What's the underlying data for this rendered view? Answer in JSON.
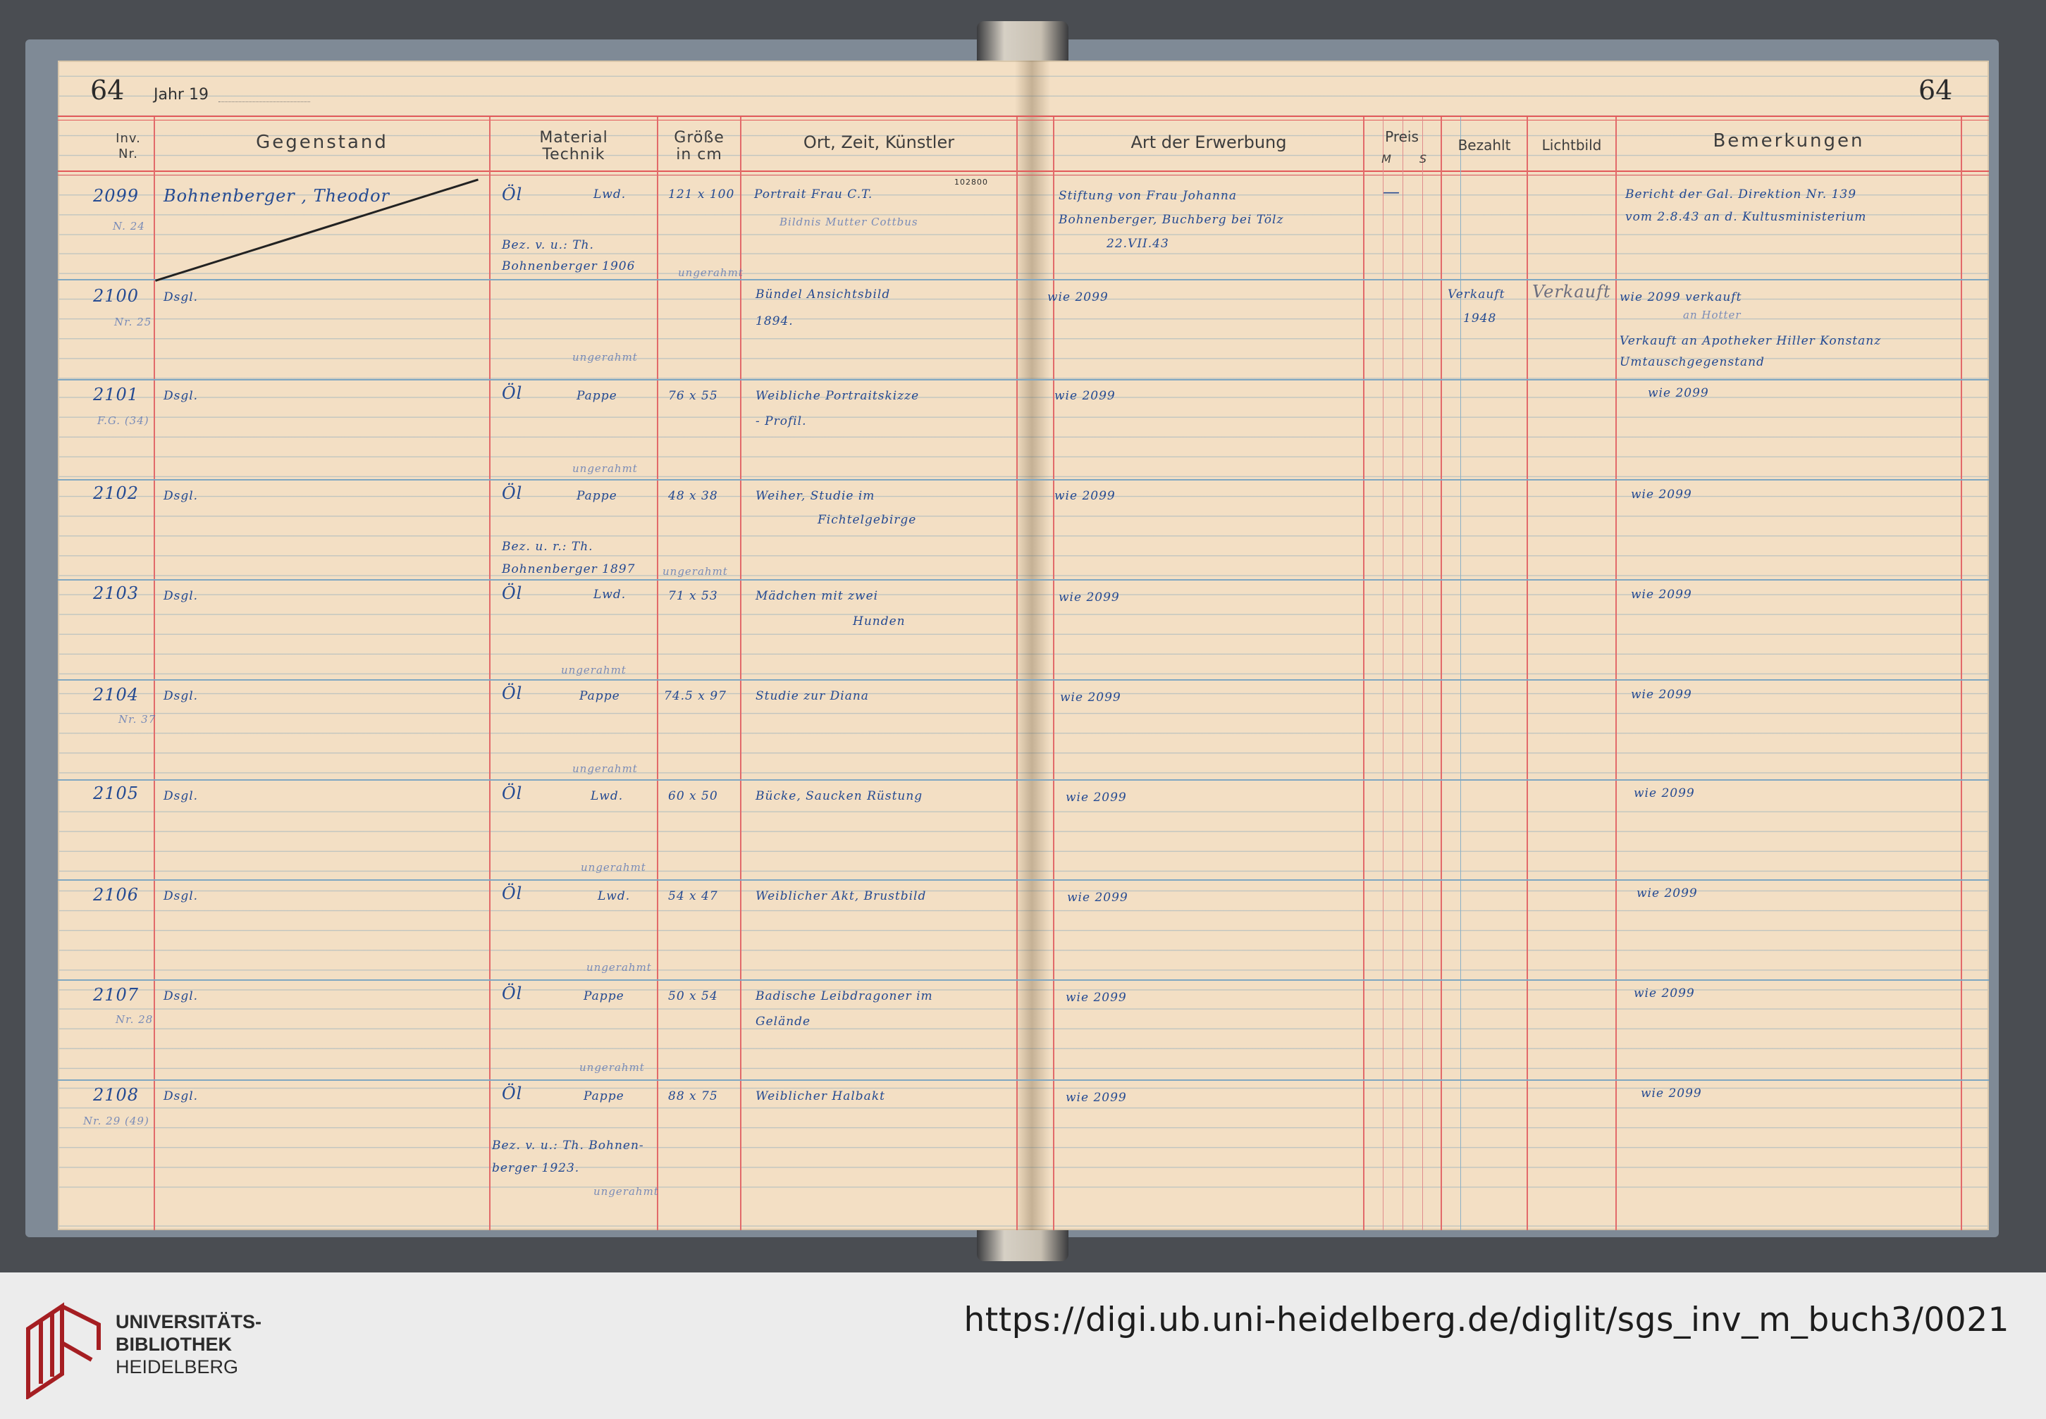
{
  "ledger": {
    "page_left": "64",
    "page_right": "64",
    "year_label": "Jahr 19",
    "headers": {
      "inv": "Inv.\nNr.",
      "gegenstand": "Gegenstand",
      "material": "Material\nTechnik",
      "groesse": "Größe\nin cm",
      "ort": "Ort, Zeit, Künstler",
      "erwerbung": "Art der Erwerbung",
      "preis": "Preis",
      "preis_m": "M",
      "preis_pf": "S",
      "bezahlt": "Bezahlt",
      "lichtbild": "Lichtbild",
      "bemerkungen": "Bemerkungen"
    },
    "stamp_number": "102800",
    "rows": [
      {
        "nr": "2099",
        "sub": "N. 24",
        "gegenstand": "Bohnenberger , Theodor",
        "material": "Öl",
        "technik": "Lwd.",
        "note": "Bez. v. u.: Th.",
        "note2": "Bohnenberger 1906",
        "gerahmt": "ungerahmt",
        "groesse": "121 x 100",
        "ort": "Portrait Frau C.T.",
        "ort2": "Bildnis Mutter Cottbus",
        "erwerbung": "Stiftung von Frau Johanna",
        "erwerbung2": "Bohnenberger, Buchberg bei Tölz",
        "erwerbung3": "22.VII.43",
        "preis": "—",
        "bemerkung": "Bericht der Gal. Direktion Nr. 139",
        "bemerkung2": "vom 2.8.43 an d. Kultusministerium"
      },
      {
        "nr": "2100",
        "sub": "Nr. 25",
        "gegenstand": "Dsgl.",
        "gerahmt": "ungerahmt",
        "ort": "Bündel Ansichtsbild",
        "ort2": "1894.",
        "erwerbung": "wie 2099",
        "bezahlt": "Verkauft",
        "bezahlt2": "1948",
        "lichtbild": "Verkauft",
        "bemerkung": "wie 2099 verkauft",
        "bemerkung2": "an Hotter",
        "bemerkung3": "Verkauft an Apotheker Hiller Konstanz",
        "bemerkung4": "Umtauschgegenstand"
      },
      {
        "nr": "2101",
        "sub": "F.G. (34)",
        "gegenstand": "Dsgl.",
        "material": "Öl",
        "technik": "Pappe",
        "gerahmt": "ungerahmt",
        "groesse": "76 x 55",
        "ort": "Weibliche Portraitskizze",
        "ort2": "- Profil.",
        "erwerbung": "wie 2099",
        "bemerkung": "wie 2099"
      },
      {
        "nr": "2102",
        "gegenstand": "Dsgl.",
        "material": "Öl",
        "technik": "Pappe",
        "note": "Bez. u. r.: Th.",
        "note2": "Bohnenberger 1897",
        "gerahmt": "ungerahmt",
        "groesse": "48 x 38",
        "ort": "Weiher, Studie im",
        "ort2": "Fichtelgebirge",
        "erwerbung": "wie 2099",
        "bemerkung": "wie 2099"
      },
      {
        "nr": "2103",
        "gegenstand": "Dsgl.",
        "material": "Öl",
        "technik": "Lwd.",
        "gerahmt": "ungerahmt",
        "groesse": "71 x 53",
        "ort": "Mädchen mit zwei",
        "ort2": "Hunden",
        "erwerbung": "wie 2099",
        "bemerkung": "wie 2099"
      },
      {
        "nr": "2104",
        "sub": "Nr. 37",
        "gegenstand": "Dsgl.",
        "material": "Öl",
        "technik": "Pappe",
        "gerahmt": "ungerahmt",
        "groesse": "74.5 x 97",
        "ort": "Studie zur Diana",
        "erwerbung": "wie 2099",
        "bemerkung": "wie 2099"
      },
      {
        "nr": "2105",
        "gegenstand": "Dsgl.",
        "material": "Öl",
        "technik": "Lwd.",
        "gerahmt": "ungerahmt",
        "groesse": "60 x 50",
        "ort": "Bücke, Saucken Rüstung",
        "erwerbung": "wie 2099",
        "bemerkung": "wie 2099"
      },
      {
        "nr": "2106",
        "gegenstand": "Dsgl.",
        "material": "Öl",
        "technik": "Lwd.",
        "gerahmt": "ungerahmt",
        "groesse": "54 x 47",
        "ort": "Weiblicher Akt, Brustbild",
        "erwerbung": "wie 2099",
        "bemerkung": "wie 2099"
      },
      {
        "nr": "2107",
        "sub": "Nr. 28",
        "gegenstand": "Dsgl.",
        "material": "Öl",
        "technik": "Pappe",
        "gerahmt": "ungerahmt",
        "groesse": "50 x 54",
        "ort": "Badische Leibdragoner im",
        "ort2": "Gelände",
        "erwerbung": "wie 2099",
        "bemerkung": "wie 2099"
      },
      {
        "nr": "2108",
        "sub": "Nr. 29 (49)",
        "gegenstand": "Dsgl.",
        "material": "Öl",
        "technik": "Pappe",
        "note": "Bez. v. u.: Th. Bohnen-",
        "note2": "berger 1923.",
        "gerahmt": "ungerahmt",
        "groesse": "88 x 75",
        "ort": "Weiblicher Halbakt",
        "erwerbung": "wie 2099",
        "bemerkung": "wie 2099"
      }
    ]
  },
  "footer": {
    "logo_line1": "UNIVERSITÄTS-",
    "logo_line2": "BIBLIOTHEK",
    "logo_line3": "HEIDELBERG",
    "url": "https://digi.ub.uni-heidelberg.de/diglit/sgs_inv_m_buch3/0021",
    "logo_color": "#a51e22"
  }
}
